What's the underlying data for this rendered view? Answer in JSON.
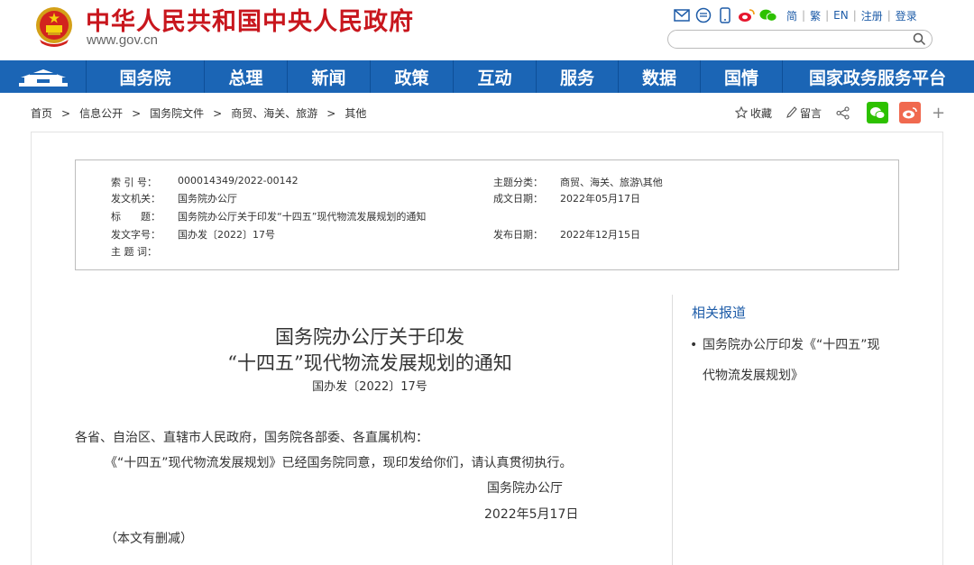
{
  "header": {
    "site_title": "中华人民共和国中央人民政府",
    "site_url": "www.gov.cn",
    "lang_links": [
      "简",
      "繁",
      "EN",
      "注册",
      "登录"
    ],
    "search_placeholder": ""
  },
  "nav": {
    "items": [
      "国务院",
      "总理",
      "新闻",
      "政策",
      "互动",
      "服务",
      "数据",
      "国情",
      "国家政务服务平台"
    ]
  },
  "breadcrumb": {
    "items": [
      "首页",
      "信息公开",
      "国务院文件",
      "商贸、海关、旅游",
      "其他"
    ]
  },
  "actions": {
    "favorite": "收藏",
    "comment": "留言",
    "plus": "+"
  },
  "meta": {
    "index_label": "索 引 号：",
    "index_value": "000014349/2022-00142",
    "issuer_label": "发文机关：",
    "issuer_value": "国务院办公厅",
    "title_label": "标　　题：",
    "title_value": "国务院办公厅关于印发“十四五”现代物流发展规划的通知",
    "docno_label": "发文字号：",
    "docno_value": "国办发〔2022〕17号",
    "keywords_label": "主 题 词：",
    "keywords_value": "",
    "category_label": "主题分类：",
    "category_value": "商贸、海关、旅游\\其他",
    "written_label": "成文日期：",
    "written_value": "2022年05月17日",
    "published_label": "发布日期：",
    "published_value": "2022年12月15日"
  },
  "related": {
    "title": "相关报道",
    "items": [
      "国务院办公厅印发《“十四五”现代物流发展规划》"
    ]
  },
  "article": {
    "title_line1": "国务院办公厅关于印发",
    "title_line2": "“十四五”现代物流发展规划的通知",
    "doc_number": "国办发〔2022〕17号",
    "salutation": "各省、自治区、直辖市人民政府，国务院各部委、各直属机构：",
    "paragraph1": "《“十四五”现代物流发展规划》已经国务院同意，现印发给你们，请认真贯彻执行。",
    "signature": "国务院办公厅",
    "date": "2022年5月17日",
    "note": "（本文有删减）"
  },
  "colors": {
    "brand_red": "#c8161d",
    "nav_blue": "#1b65b5",
    "link_blue": "#1e5ca8",
    "wechat_green": "#2dc100",
    "weibo_orange": "#f0694f"
  }
}
